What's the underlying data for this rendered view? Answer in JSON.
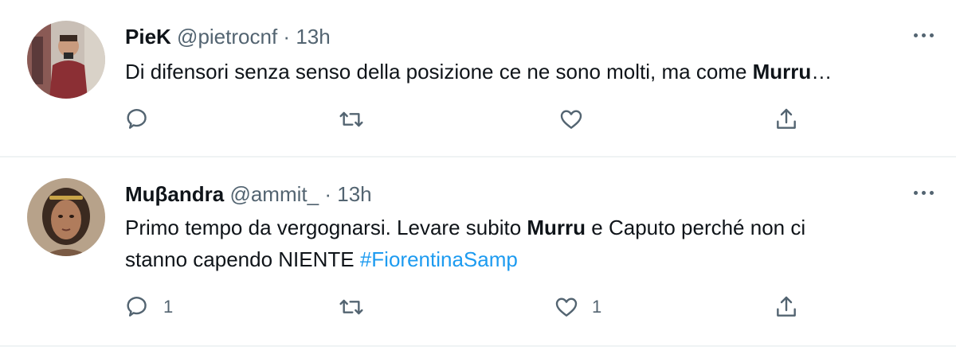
{
  "tweets": [
    {
      "name": "PieK",
      "handle": "@pietrocnf",
      "separator": "·",
      "time": "13h",
      "text_before": "Di difensori senza senso della posizione ce ne sono molti, ma come ",
      "text_bold": "Murru",
      "text_after": "…",
      "reply_count": "",
      "retweet_count": "",
      "like_count": ""
    },
    {
      "name": "Muβandra",
      "handle": "@ammit_",
      "separator": "·",
      "time": "13h",
      "line1_before": "Primo tempo da vergognarsi. Levare subito ",
      "line1_bold": "Murru",
      "line1_after": " e Caputo perché non ci",
      "line2_before": "stanno capendo NIENTE ",
      "hashtag": "#FiorentinaSamp",
      "reply_count": "1",
      "retweet_count": "",
      "like_count": "1"
    }
  ],
  "icons": {
    "reply": "reply-icon",
    "retweet": "retweet-icon",
    "like": "heart-icon",
    "share": "share-icon",
    "more": "more-icon"
  },
  "colors": {
    "link": "#1d9bf0",
    "secondary_text": "#536471",
    "divider": "#eff3f4"
  }
}
